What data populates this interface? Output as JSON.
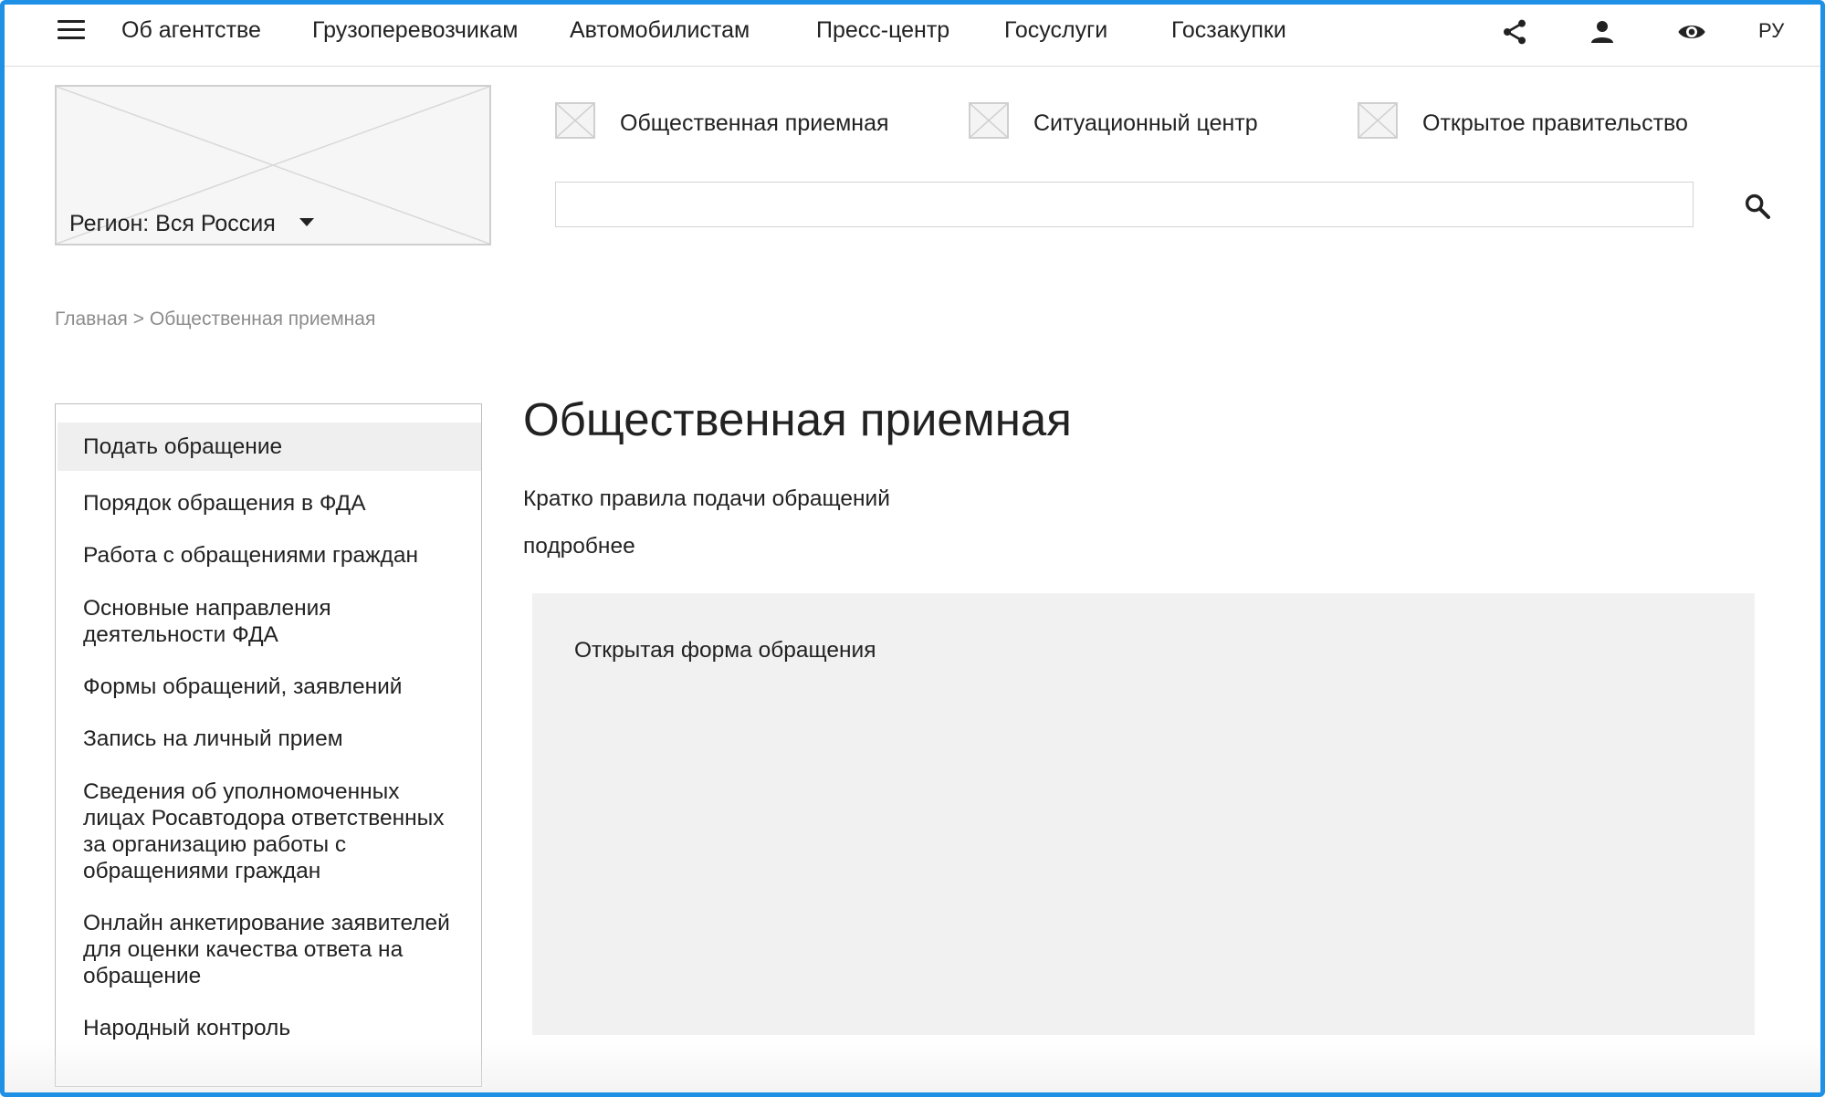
{
  "nav": {
    "links": [
      "Об агентстве",
      "Грузоперевозчикам",
      "Автомобилистам",
      "Пресс-центр",
      "Госуслуги",
      "Госзакупки"
    ],
    "icons": [
      "menu-icon",
      "share-icon",
      "user-icon",
      "eye-icon"
    ],
    "language": "РУ"
  },
  "header": {
    "region_label": "Регион: Вся Россия",
    "quick_links": [
      "Общественная приемная",
      "Ситуационный центр",
      "Открытое правительство"
    ],
    "search": {
      "value": "",
      "placeholder": ""
    }
  },
  "breadcrumb": {
    "home": "Главная",
    "separator": ">",
    "current": "Общественная приемная"
  },
  "sidebar": {
    "items": [
      "Подать обращение",
      "Порядок обращения в ФДА",
      "Работа с обращениями граждан",
      "Основные направления деятельности ФДА",
      "Формы обращений, заявлений",
      "Запись на личный прием",
      "Сведения об уполномоченных лицах Росавтодора ответственных за организацию работы с обращениями граждан",
      "Онлайн анкетирование заявителей для оценки качества ответа на обращение",
      "Народный контроль"
    ],
    "active_index": 0
  },
  "main": {
    "title": "Общественная приемная",
    "intro": "Кратко правила подачи обращений",
    "more_link": "подробнее",
    "form": {
      "title": "Открытая форма обращения"
    }
  },
  "colors": {
    "frame_border": "#1e90e6",
    "active_item_bg": "#efefef",
    "form_bg": "#f1f1f1",
    "breadcrumb_text": "#8c8c8c"
  }
}
